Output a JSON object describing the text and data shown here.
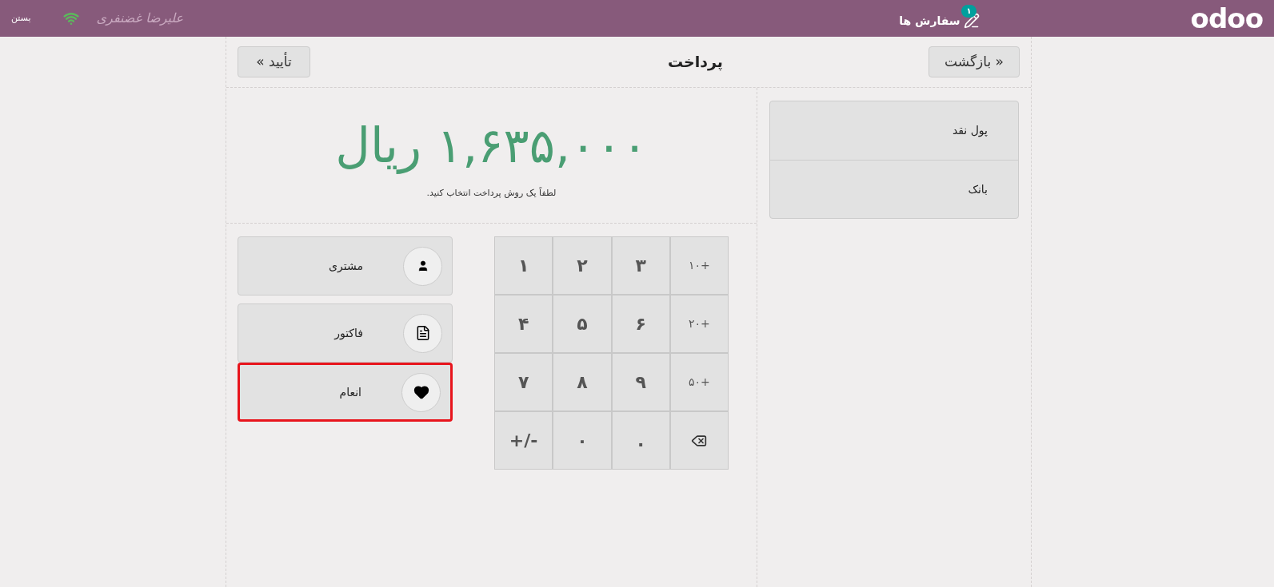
{
  "top_bar": {
    "close_label": "بستن",
    "user_name": "علیرضا غضنفری",
    "orders": {
      "label": "سفارش ها",
      "count": "۱"
    },
    "logo": "odoo"
  },
  "header": {
    "back_button": "« بازگشت",
    "title": "پرداخت",
    "confirm_button": "تأیید »"
  },
  "amount": {
    "value": "۱,۶۳۵,۰۰۰ ریال",
    "hint": "لطفاً یک روش پرداخت انتخاب کنید."
  },
  "payment_methods": [
    {
      "label": "پول نقد"
    },
    {
      "label": "بانک"
    }
  ],
  "actions": [
    {
      "label": "مشتری",
      "kind": "customer",
      "highlighted": false
    },
    {
      "label": "فاکتور",
      "kind": "invoice",
      "highlighted": false
    },
    {
      "label": "انعام",
      "kind": "tip",
      "highlighted": true
    }
  ],
  "keypad": [
    {
      "kind": "increment",
      "label": "+۱۰"
    },
    {
      "kind": "digit",
      "label": "۳"
    },
    {
      "kind": "digit",
      "label": "۲"
    },
    {
      "kind": "digit",
      "label": "۱"
    },
    {
      "kind": "increment",
      "label": "+۲۰"
    },
    {
      "kind": "digit",
      "label": "۶"
    },
    {
      "kind": "digit",
      "label": "۵"
    },
    {
      "kind": "digit",
      "label": "۴"
    },
    {
      "kind": "increment",
      "label": "+۵۰"
    },
    {
      "kind": "digit",
      "label": "۹"
    },
    {
      "kind": "digit",
      "label": "۸"
    },
    {
      "kind": "digit",
      "label": "۷"
    },
    {
      "kind": "backspace"
    },
    {
      "kind": "digit",
      "label": "."
    },
    {
      "kind": "digit",
      "label": "۰"
    },
    {
      "kind": "digit",
      "label": "-/+"
    }
  ]
}
